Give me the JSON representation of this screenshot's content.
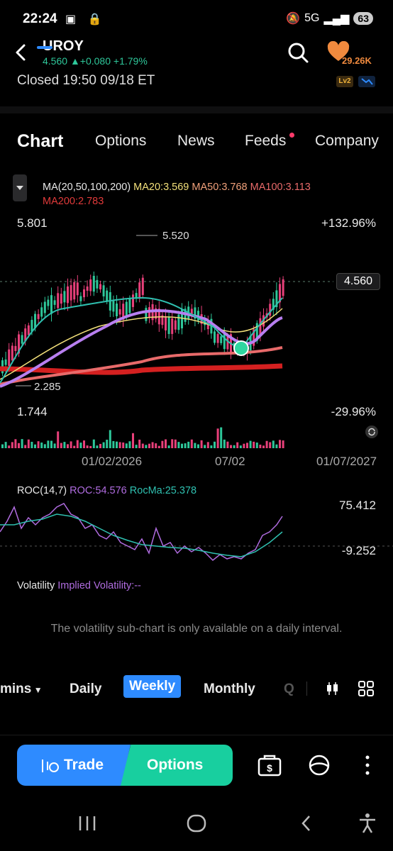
{
  "status_bar": {
    "time": "22:24",
    "network": "5G",
    "battery": "63"
  },
  "header": {
    "ticker": "UROY",
    "price": "4.560",
    "change": "+0.080",
    "change_pct": "+1.79%",
    "closed_text": "Closed 19:50 09/18 ET",
    "watch_count": "29.26K",
    "level2": "Lv2"
  },
  "tabs": [
    "Chart",
    "Options",
    "News",
    "Feeds",
    "Company"
  ],
  "ma": {
    "label": "MA(20,50,100,200)",
    "ma20": "MA20:3.569",
    "ma50": "MA50:3.768",
    "ma100": "MA100:3.113",
    "ma200": "MA200:2.783",
    "colors": {
      "ma20": "#f3e07a",
      "ma50": "#f0a07a",
      "ma100": "#e86a6a",
      "ma200": "#d42020"
    }
  },
  "price_chart": {
    "max_label": "5.801",
    "min_label": "1.744",
    "max_pct": "+132.96%",
    "min_pct": "-29.96%",
    "high_marker": "5.520",
    "low_marker": "2.285",
    "last_price": "4.560"
  },
  "dates": [
    "01/02/2026",
    "07/02",
    "01/07/2027"
  ],
  "roc": {
    "label": "ROC(14,7)",
    "roc": "ROC:54.576",
    "rocma": "RocMa:25.378",
    "top": "75.412",
    "bottom": "-9.252",
    "colors": {
      "roc": "#b06ce0",
      "rocma": "#2fc0b0"
    }
  },
  "volatility": {
    "label": "Volatility",
    "iv": "Implied Volatility:--",
    "message": "The volatility sub-chart is only available on a daily interval."
  },
  "intervals": {
    "mins": "mins",
    "daily": "Daily",
    "weekly": "Weekly",
    "monthly": "Monthly",
    "quarterly": "Q"
  },
  "actions": {
    "trade": "Trade",
    "options": "Options"
  },
  "colors": {
    "up": "#2ec79a",
    "down": "#e8407a",
    "accent": "#2e8bff",
    "options": "#18cf9f"
  }
}
